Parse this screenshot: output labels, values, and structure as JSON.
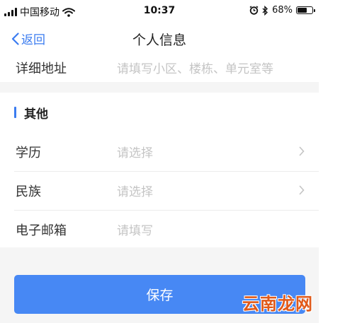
{
  "status_bar": {
    "carrier": "中国移动",
    "time": "10:37",
    "battery_text": "68%",
    "battery_level": 0.68
  },
  "nav": {
    "back_label": "返回",
    "title": "个人信息"
  },
  "address_row": {
    "label": "详细地址",
    "placeholder": "请填写小区、楼栋、单元室等"
  },
  "other_section": {
    "title": "其他",
    "rows": [
      {
        "label": "学历",
        "value": "请选择",
        "has_chevron": true
      },
      {
        "label": "民族",
        "value": "请选择",
        "has_chevron": true
      },
      {
        "label": "电子邮箱",
        "value": "请填写",
        "has_chevron": false
      }
    ]
  },
  "save_button": {
    "label": "保存"
  },
  "watermark": {
    "text": "云南龙网"
  },
  "colors": {
    "accent": "#3b7cf0",
    "button": "#4788f4",
    "placeholder": "#c4c4c4",
    "watermark": "#e05a1a"
  }
}
